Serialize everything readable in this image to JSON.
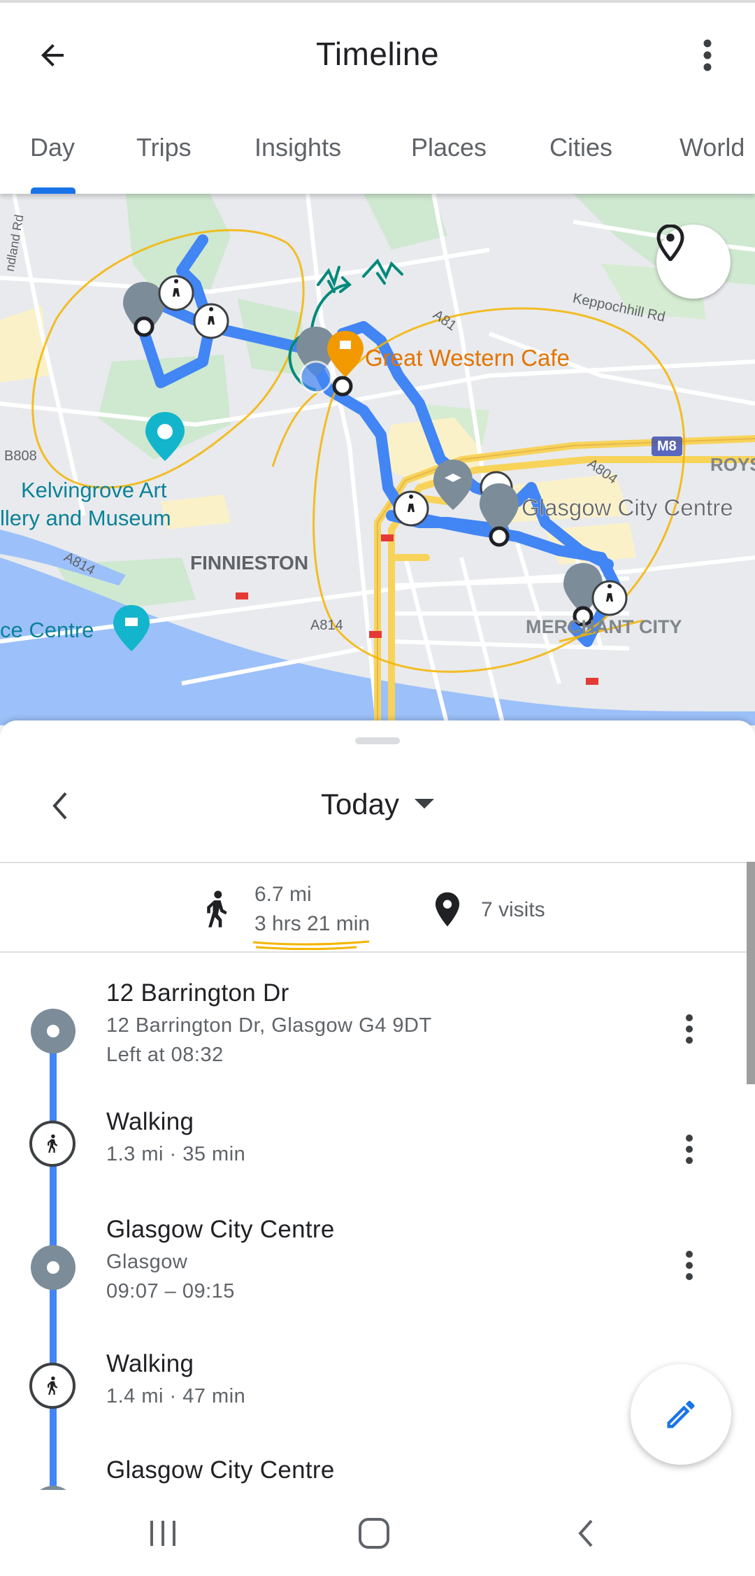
{
  "header": {
    "title": "Timeline",
    "back_icon": "arrow-back-icon",
    "overflow_icon": "more-vert-icon"
  },
  "tabs": [
    {
      "label": "Day",
      "active": true
    },
    {
      "label": "Trips",
      "active": false
    },
    {
      "label": "Insights",
      "active": false
    },
    {
      "label": "Places",
      "active": false
    },
    {
      "label": "Cities",
      "active": false
    },
    {
      "label": "World",
      "active": false
    }
  ],
  "map": {
    "labels": {
      "cafe": "Great Western Cafe",
      "city_centre": "Glasgow City Centre",
      "kelvingrove_1": "Kelvingrove Art",
      "kelvingrove_2": "llery and Museum",
      "finnieston": "FINNIESTON",
      "merchant_city": "MERCHANT CITY",
      "centre": "ce Centre",
      "keppochhill": "Keppochhill Rd",
      "road_a81": "A81",
      "road_a804": "A804",
      "road_a814_1": "A814",
      "road_a814_2": "A814",
      "road_b808": "B808",
      "road_m8": "M8",
      "roys": "ROYS",
      "wyndland": "ndland Rd"
    },
    "route_color": "#4285f4",
    "annotation_color": "#f4b400"
  },
  "sheet": {
    "date_label": "Today",
    "summary": {
      "distance": "6.7 mi",
      "duration": "3 hrs 21 min",
      "visits": "7 visits"
    }
  },
  "entries": [
    {
      "type": "place",
      "title": "12 Barrington Dr",
      "line1": "12 Barrington Dr, Glasgow G4 9DT",
      "line2": "Left at 08:32"
    },
    {
      "type": "walk",
      "title": "Walking",
      "line1": "1.3 mi · 35 min"
    },
    {
      "type": "place",
      "title": "Glasgow City Centre",
      "line1": "Glasgow",
      "line2": "09:07 – 09:15"
    },
    {
      "type": "walk",
      "title": "Walking",
      "line1": "1.4 mi · 47 min"
    },
    {
      "type": "place",
      "title": "Glasgow City Centre"
    }
  ],
  "fab_icon": "edit-pencil-icon",
  "nav": {
    "recents_icon": "recents-icon",
    "home_icon": "home-icon",
    "back_icon": "nav-back-icon"
  }
}
